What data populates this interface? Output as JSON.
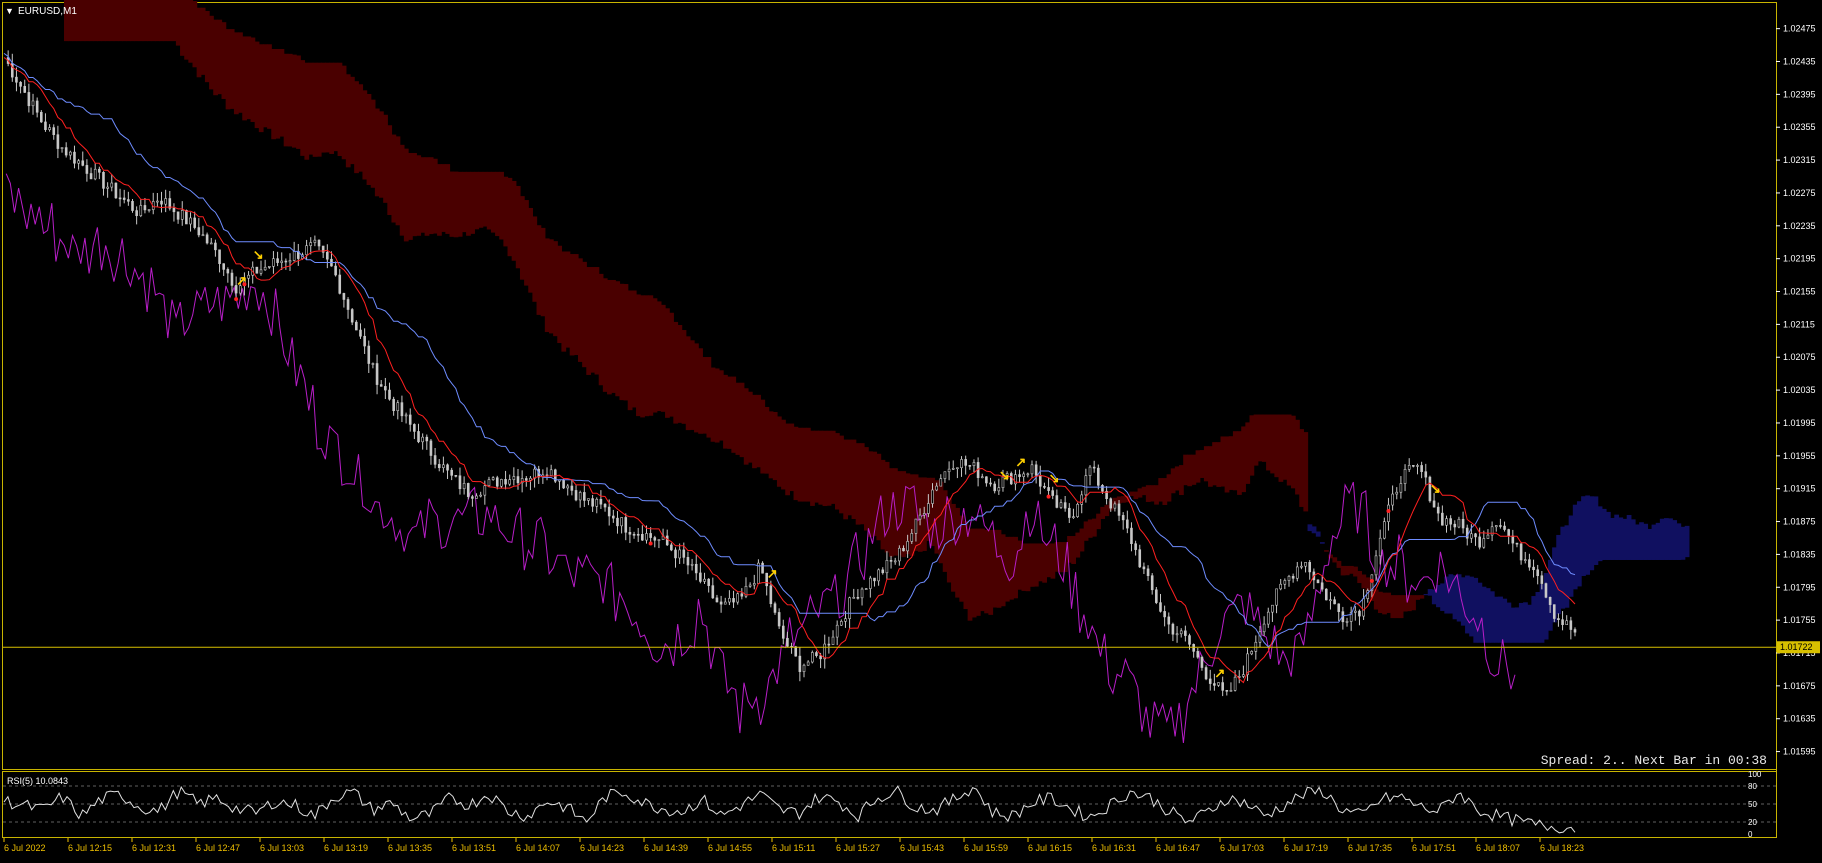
{
  "window": {
    "title": "EURUSD,M1"
  },
  "main_chart": {
    "symbol": "EURUSD",
    "timeframe": "M1",
    "y_ticks": [
      "1.02475",
      "1.02435",
      "1.02395",
      "1.02355",
      "1.02315",
      "1.02275",
      "1.02235",
      "1.02195",
      "1.02155",
      "1.02115",
      "1.02075",
      "1.02035",
      "1.01995",
      "1.01955",
      "1.01915",
      "1.01875",
      "1.01835",
      "1.01795",
      "1.01755",
      "1.01715",
      "1.01675",
      "1.01635",
      "1.01595"
    ],
    "current_price_label": "1.01722",
    "current_price": 1.01722,
    "status_text": "Spread: 2.. Next Bar in 00:38"
  },
  "rsi_panel": {
    "title": "RSI(5) 10.0843",
    "y_ticks": [
      "100",
      "80",
      "50",
      "20",
      "0"
    ]
  },
  "time_axis": {
    "labels": [
      "6 Jul 2022",
      "6 Jul 12:15",
      "6 Jul 12:31",
      "6 Jul 12:47",
      "6 Jul 13:03",
      "6 Jul 13:19",
      "6 Jul 13:35",
      "6 Jul 13:51",
      "6 Jul 14:07",
      "6 Jul 14:23",
      "6 Jul 14:39",
      "6 Jul 14:55",
      "6 Jul 15:11",
      "6 Jul 15:27",
      "6 Jul 15:43",
      "6 Jul 15:59",
      "6 Jul 16:15",
      "6 Jul 16:31",
      "6 Jul 16:47",
      "6 Jul 17:03",
      "6 Jul 17:19",
      "6 Jul 17:35",
      "6 Jul 17:51",
      "6 Jul 18:07",
      "6 Jul 18:23"
    ]
  },
  "colors": {
    "background": "#000000",
    "border": "#c8b400",
    "axis_text": "#ffffff",
    "time_text": "#f0c000",
    "candles": "#c8c8c8",
    "tenkan": "#ff2020",
    "kijun": "#6e8cff",
    "chikou": "#b81ec8",
    "kumo_bear": "#4a0000",
    "kumo_bull": "#101060",
    "arrows": "#ffd000",
    "current_line": "#d8c000",
    "status": "#e8e8e8"
  },
  "chart_data": [
    {
      "type": "candlestick",
      "title": "EURUSD,M1",
      "ylim": [
        1.01575,
        1.02505
      ],
      "series": [
        {
          "name": "Close",
          "values": [
            1.0244,
            1.024,
            1.0236,
            1.0233,
            1.0231,
            1.0229,
            1.0227,
            1.0225,
            1.0227,
            1.0225,
            1.0223,
            1.022,
            1.0216,
            1.0218,
            1.0219,
            1.022,
            1.0221,
            1.0218,
            1.0212,
            1.0206,
            1.0202,
            1.0199,
            1.0196,
            1.0193,
            1.0191,
            1.0192,
            1.0193,
            1.0193,
            1.0194,
            1.0192,
            1.019,
            1.0189,
            1.0187,
            1.0186,
            1.0185,
            1.0183,
            1.018,
            1.0177,
            1.0178,
            1.0182,
            1.0174,
            1.017,
            1.0171,
            1.0175,
            1.0179,
            1.0181,
            1.0183,
            1.0187,
            1.0192,
            1.0195,
            1.0194,
            1.0192,
            1.0193,
            1.0194,
            1.019,
            1.0188,
            1.0194,
            1.019,
            1.0186,
            1.018,
            1.0175,
            1.0173,
            1.0169,
            1.0166,
            1.017,
            1.0176,
            1.018,
            1.0183,
            1.0179,
            1.0176,
            1.0177,
            1.0186,
            1.0193,
            1.0194,
            1.0188,
            1.0187,
            1.0185,
            1.0188,
            1.0184,
            1.0182,
            1.0176,
            1.0174
          ]
        },
        {
          "name": "Tenkan-sen"
        },
        {
          "name": "Kijun-sen"
        },
        {
          "name": "Chikou Span"
        },
        {
          "name": "Kumo"
        }
      ]
    },
    {
      "type": "line",
      "title": "RSI(5) 10.0843",
      "ylim": [
        0,
        100
      ],
      "levels": [
        20,
        50,
        80
      ],
      "series": [
        {
          "name": "RSI(5)",
          "values": [
            55,
            48,
            40,
            62,
            30,
            58,
            66,
            45,
            38,
            72,
            50,
            60,
            42,
            35,
            55,
            48,
            30,
            62,
            70,
            40,
            52,
            25,
            33,
            60,
            48,
            68,
            38,
            30,
            55,
            45,
            20,
            62,
            70,
            52,
            42,
            38,
            58,
            30,
            48,
            66,
            40,
            35,
            62,
            55,
            30,
            60,
            72,
            45,
            40,
            58,
            80,
            35,
            30,
            52,
            60,
            42,
            28,
            48,
            70,
            62,
            40,
            20,
            35,
            60,
            52,
            30,
            48,
            66,
            72,
            40,
            30,
            58,
            62,
            45,
            38,
            70,
            40,
            30,
            22,
            15,
            12,
            10
          ]
        }
      ]
    }
  ]
}
